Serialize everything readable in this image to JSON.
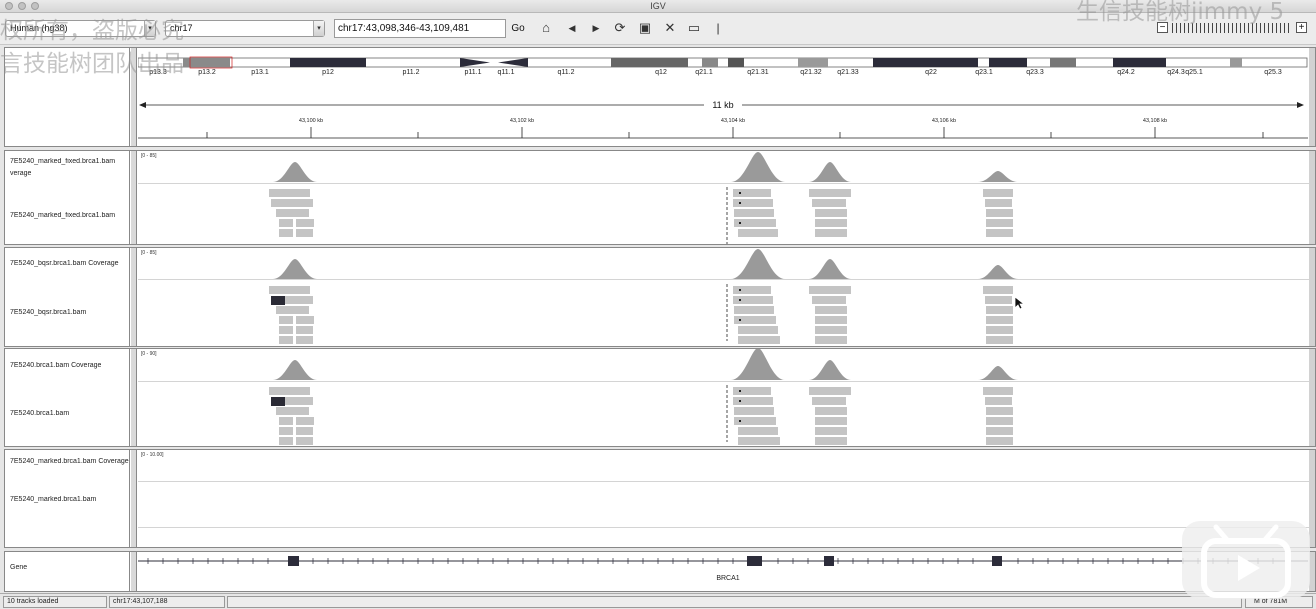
{
  "window": {
    "title": "IGV"
  },
  "toolbar": {
    "genome": "Human (hg38)",
    "chromosome": "chr17",
    "locus": "chr17:43,098,346-43,109,481",
    "go_label": "Go",
    "zoom_minus": "−",
    "zoom_plus": "+"
  },
  "watermarks": {
    "top_left_1": "权所有，盗版必究",
    "top_left_2": "言技能树团队出品",
    "top_right": "生信技能树jimmy 5"
  },
  "ideogram": {
    "bands": [
      "p13.3",
      "p13.2",
      "p13.1",
      "p12",
      "p11.2",
      "p11.1",
      "q11.1",
      "q11.2",
      "q12",
      "q21.1",
      "q21.31",
      "q21.32",
      "q21.33",
      "q22",
      "q23.1",
      "q23.3",
      "q24.2",
      "q24.3",
      "q25.1",
      "q25.3"
    ]
  },
  "ruler": {
    "span_label": "11 kb",
    "ticks": [
      "43,100 kb",
      "43,102 kb",
      "43,104 kb",
      "43,106 kb",
      "43,108 kb"
    ]
  },
  "tracks": [
    {
      "coverage_name": "7E5240_marked_fixed.brca1.bam",
      "coverage_name2": "verage",
      "range": "[0 - 85]",
      "alignment_name": "7E5240_marked_fixed.brca1.bam"
    },
    {
      "coverage_name": "7E5240_bqsr.brca1.bam Coverage",
      "range": "[0 - 85]",
      "alignment_name": "7E5240_bqsr.brca1.bam"
    },
    {
      "coverage_name": "7E5240.brca1.bam Coverage",
      "range": "[0 - 90]",
      "alignment_name": "7E5240.brca1.bam"
    },
    {
      "coverage_name": "7E5240_marked.brca1.bam Coverage",
      "range": "[0 - 10.00]",
      "alignment_name": "7E5240_marked.brca1.bam"
    }
  ],
  "gene_track": {
    "name": "Gene",
    "gene_label": "BRCA1"
  },
  "status": {
    "tracks_loaded": "10 tracks loaded",
    "position": "chr17:43,107,188",
    "memory": "M of 781M"
  },
  "colors": {
    "coverage": "#9a9a9a",
    "read": "#c4c4c4",
    "highlight_read": "#2a2a35",
    "exon": "#2c2c3a"
  }
}
